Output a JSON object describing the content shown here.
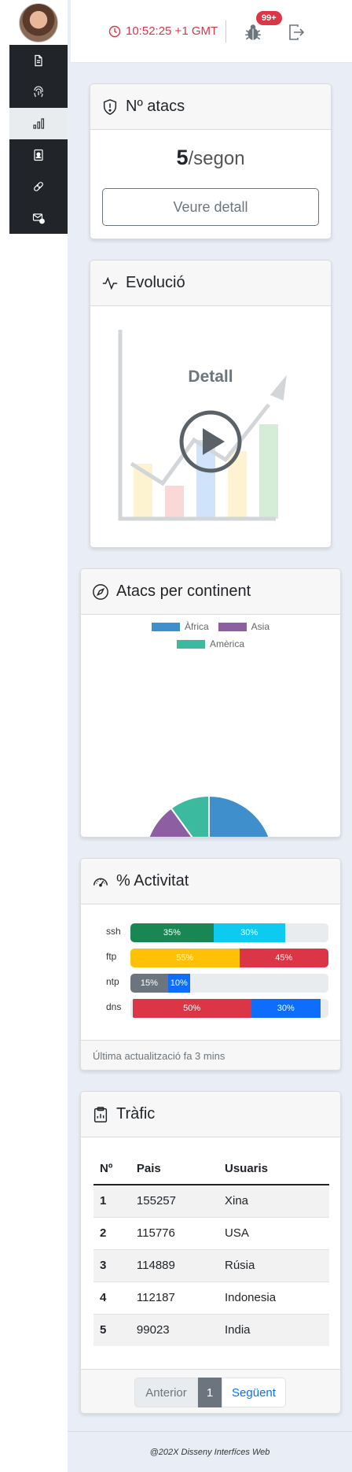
{
  "sidebar": {
    "items": [
      {
        "icon": "document-icon",
        "active": false
      },
      {
        "icon": "fingerprint-icon",
        "active": false
      },
      {
        "icon": "bar-chart-icon",
        "active": true
      },
      {
        "icon": "contact-card-icon",
        "active": false
      },
      {
        "icon": "bandage-icon",
        "active": false
      },
      {
        "icon": "envelope-alert-icon",
        "active": false
      }
    ]
  },
  "topbar": {
    "time": "10:52:25 +1 GMT",
    "bug_badge": "99+"
  },
  "attacks_card": {
    "title": "Nº atacs",
    "rate_value": "5",
    "rate_unit": "/segon",
    "button": "Veure detall"
  },
  "evolution_card": {
    "title": "Evolució",
    "overlay_label": "Detall"
  },
  "continent_card": {
    "title": "Atacs per continent",
    "colors": {
      "Àfrica": "#3f8fcd",
      "Asia": "#8e5ea2",
      "Amèrica": "#3cba9f"
    }
  },
  "activity_card": {
    "title": "% Activitat",
    "rows": [
      {
        "label": "ssh",
        "segments": [
          {
            "text": "35%",
            "value": 35,
            "color": "#198754"
          },
          {
            "text": "30%",
            "value": 30,
            "color": "#0dcaf0"
          }
        ]
      },
      {
        "label": "ftp",
        "segments": [
          {
            "text": "55%",
            "value": 55,
            "color": "#ffc107"
          },
          {
            "text": "45%",
            "value": 45,
            "color": "#dc3545"
          }
        ]
      },
      {
        "label": "ntp",
        "segments": [
          {
            "text": "15%",
            "value": 15,
            "color": "#6c757d"
          },
          {
            "text": "10%",
            "value": 10,
            "color": "#0d6efd"
          }
        ]
      },
      {
        "label": "dns",
        "segments": [
          {
            "text": "50%",
            "value": 50,
            "color": "#dc3545"
          },
          {
            "text": "30%",
            "value": 30,
            "color": "#0d6efd"
          }
        ]
      }
    ],
    "footer": "Última actualització fa 3 mins"
  },
  "traffic_card": {
    "title": "Tràfic",
    "columns": [
      "Nº",
      "Pais",
      "Usuaris"
    ],
    "rows": [
      [
        "1",
        "155257",
        "Xina"
      ],
      [
        "2",
        "115776",
        "USA"
      ],
      [
        "3",
        "114889",
        "Rúsia"
      ],
      [
        "4",
        "112187",
        "Indonesia"
      ],
      [
        "5",
        "99023",
        "India"
      ]
    ],
    "pager": {
      "prev": "Anterior",
      "current": "1",
      "next": "Següent"
    }
  },
  "footer": {
    "text": "@202X Disseny Interfíces Web"
  },
  "chart_data": {
    "type": "pie",
    "categories": [
      "Àfrica",
      "Asia",
      "Amèrica"
    ],
    "values": [
      30,
      60,
      10
    ],
    "legend_position": "top"
  }
}
